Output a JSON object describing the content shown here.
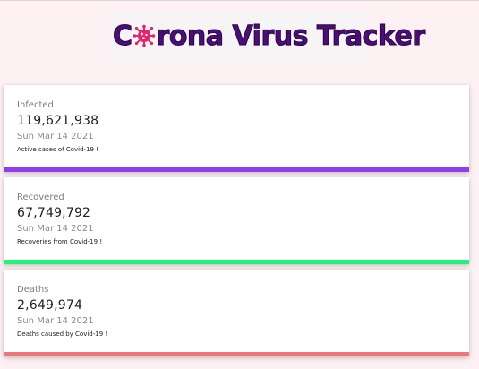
{
  "header": {
    "title_prefix": "C",
    "title_rest": "rona Virus Tracker",
    "title_color": "#4a0f74",
    "virus_icon_color": "#e6246b"
  },
  "cards": [
    {
      "label": "Infected",
      "count": "119,621,938",
      "date": "Sun Mar 14 2021",
      "description": "Active cases of Covid-19 !",
      "bar_color": "#8e3fe8"
    },
    {
      "label": "Recovered",
      "count": "67,749,792",
      "date": "Sun Mar 14 2021",
      "description": "Recoveries from Covid-19 !",
      "bar_color": "#1ff57a"
    },
    {
      "label": "Deaths",
      "count": "2,649,974",
      "date": "Sun Mar 14 2021",
      "description": "Deaths caused by Covid-19 !",
      "bar_color": "#f07579"
    }
  ]
}
